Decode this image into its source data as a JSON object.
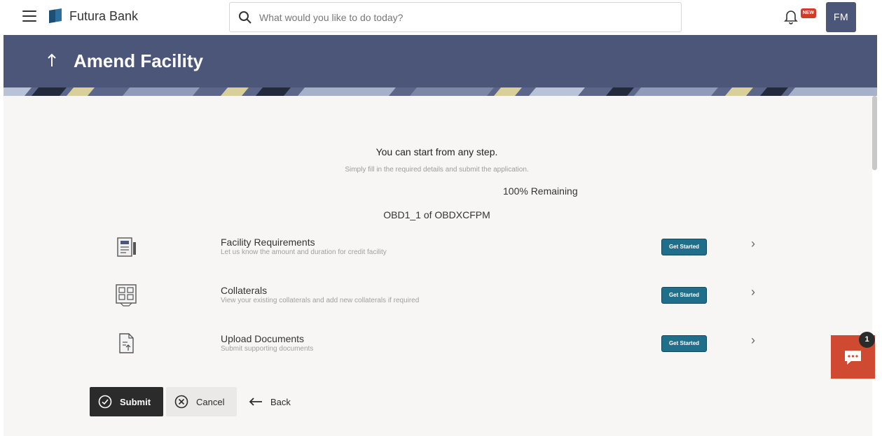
{
  "brand": {
    "name": "Futura Bank"
  },
  "search": {
    "placeholder": "What would you like to do today?"
  },
  "notifications": {
    "badge": "NEW"
  },
  "user": {
    "initials": "FM"
  },
  "page": {
    "title": "Amend Facility"
  },
  "intro": {
    "title": "You can start from any step.",
    "subtitle": "Simply fill in the required details and submit the application.",
    "remaining": "100% Remaining",
    "application_id": "OBD1_1 of OBDXCFPM"
  },
  "steps": [
    {
      "title": "Facility Requirements",
      "description": "Let us know the amount and duration for credit facility",
      "button": "Get Started",
      "icon": "facility-document-icon"
    },
    {
      "title": "Collaterals",
      "description": "View your existing collaterals and add new collaterals if required",
      "button": "Get Started",
      "icon": "collateral-icon"
    },
    {
      "title": "Upload Documents",
      "description": "Submit supporting documents",
      "button": "Get Started",
      "icon": "upload-document-icon"
    }
  ],
  "actions": {
    "submit": "Submit",
    "cancel": "Cancel",
    "back": "Back"
  },
  "chat": {
    "count": "1"
  },
  "colors": {
    "header": "#4c5679",
    "primary_button": "#1f6f8b",
    "chat": "#d04a32",
    "submit": "#2b2b2b"
  }
}
